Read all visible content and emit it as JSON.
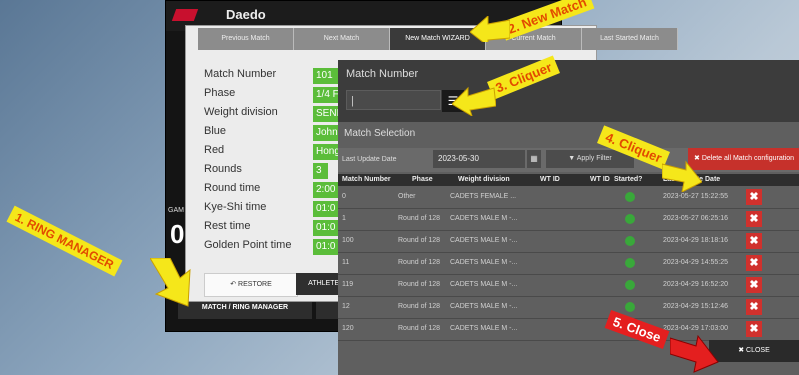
{
  "app": {
    "logo_text": "Daedo",
    "gam_label": "GAM",
    "big_number": "0",
    "ring_manager_button": "MATCH / RING MANAGER"
  },
  "match_window": {
    "tabs": [
      {
        "label": "Previous Match"
      },
      {
        "label": "Next Match"
      },
      {
        "label": "New Match WIZARD",
        "active": true
      },
      {
        "label": "Current Match"
      },
      {
        "label": "Last Started Match"
      }
    ],
    "fields": [
      {
        "label": "Match Number",
        "value": "101"
      },
      {
        "label": "Phase",
        "value": "1/4 F"
      },
      {
        "label": "Weight division",
        "value": "SENI"
      },
      {
        "label": "Blue",
        "value": "John"
      },
      {
        "label": "Red",
        "value": "Hong"
      },
      {
        "label": "Rounds",
        "value": "3"
      },
      {
        "label": "Round time",
        "value": "2:00"
      },
      {
        "label": "Kye-Shi time",
        "value": "01:0"
      },
      {
        "label": "Rest time",
        "value": "01:0"
      },
      {
        "label": "Golden Point time",
        "value": "01:0"
      }
    ],
    "restore_label": "RESTORE",
    "athletes_label": "ATHLETES"
  },
  "match_number_dialog": {
    "title": "Match Number",
    "input_value": "|"
  },
  "match_selection": {
    "title": "Match Selection",
    "last_update_label": "Last Update Date",
    "date_value": "2023-05-30",
    "apply_filter": "Apply Filter",
    "delete_all": "Delete all Match configuration",
    "columns": [
      "Match Number",
      "Phase",
      "Weight division",
      "WT ID",
      "WT ID",
      "Started?",
      "Last Update Date"
    ],
    "rows": [
      {
        "num": "0",
        "phase": "Other",
        "division": "CADETS FEMALE ...",
        "started": true,
        "date": "2023-05-27 15:22:55"
      },
      {
        "num": "1",
        "phase": "Round of 128",
        "division": "CADETS MALE M -...",
        "started": true,
        "date": "2023-05-27 06:25:16"
      },
      {
        "num": "100",
        "phase": "Round of 128",
        "division": "CADETS MALE M -...",
        "started": true,
        "date": "2023-04-29 18:18:16"
      },
      {
        "num": "11",
        "phase": "Round of 128",
        "division": "CADETS MALE M -...",
        "started": true,
        "date": "2023-04-29 14:55:25"
      },
      {
        "num": "119",
        "phase": "Round of 128",
        "division": "CADETS MALE M -...",
        "started": true,
        "date": "2023-04-29 16:52:20"
      },
      {
        "num": "12",
        "phase": "Round of 128",
        "division": "CADETS MALE M -...",
        "started": true,
        "date": "2023-04-29 15:12:46"
      },
      {
        "num": "120",
        "phase": "Round of 128",
        "division": "CADETS MALE M -...",
        "started": true,
        "date": "2023-04-29 17:03:00"
      }
    ],
    "close_label": "CLOSE"
  },
  "callouts": {
    "step1": "1. RING MANAGER",
    "step2": "2. New Match",
    "step3": "3. Cliquer",
    "step4": "4. Cliquer",
    "step5": "5. Close"
  },
  "colors": {
    "green": "#5bbd3a",
    "red": "#c6312b",
    "callout_yellow": "#f5e71a",
    "callout_red": "#e41f1f"
  }
}
